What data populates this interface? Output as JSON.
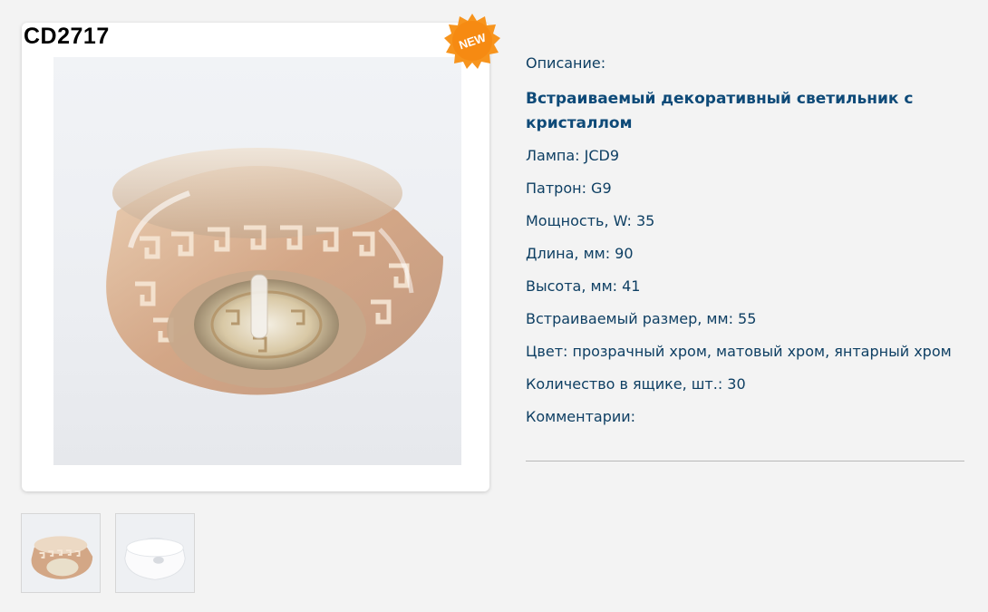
{
  "product": {
    "code": "CD2717",
    "badge": "NEW"
  },
  "colors": {
    "page_background": "#f3f3f3",
    "text": "#0e3f63",
    "badge": "#f7941d"
  },
  "details": {
    "description_label": "Описание:",
    "description_title": "Встраиваемый декоративный светильник с кристаллом",
    "lamp": "Лампа: JCD9",
    "socket": "Патрон: G9",
    "power": "Мощность, W: 35",
    "length": "Длина, мм: 90",
    "height": "Высота, мм: 41",
    "mount_size": "Встраиваемый размер, мм: 55",
    "color": "Цвет: прозрачный хром, матовый хром, янтарный хром",
    "box_quantity": "Количество в ящике, шт.: 30",
    "comments": "Комментарии:"
  },
  "thumbnails": [
    {
      "icon": "amber-crystal-light-photo"
    },
    {
      "icon": "white-frosted-light-photo"
    }
  ]
}
